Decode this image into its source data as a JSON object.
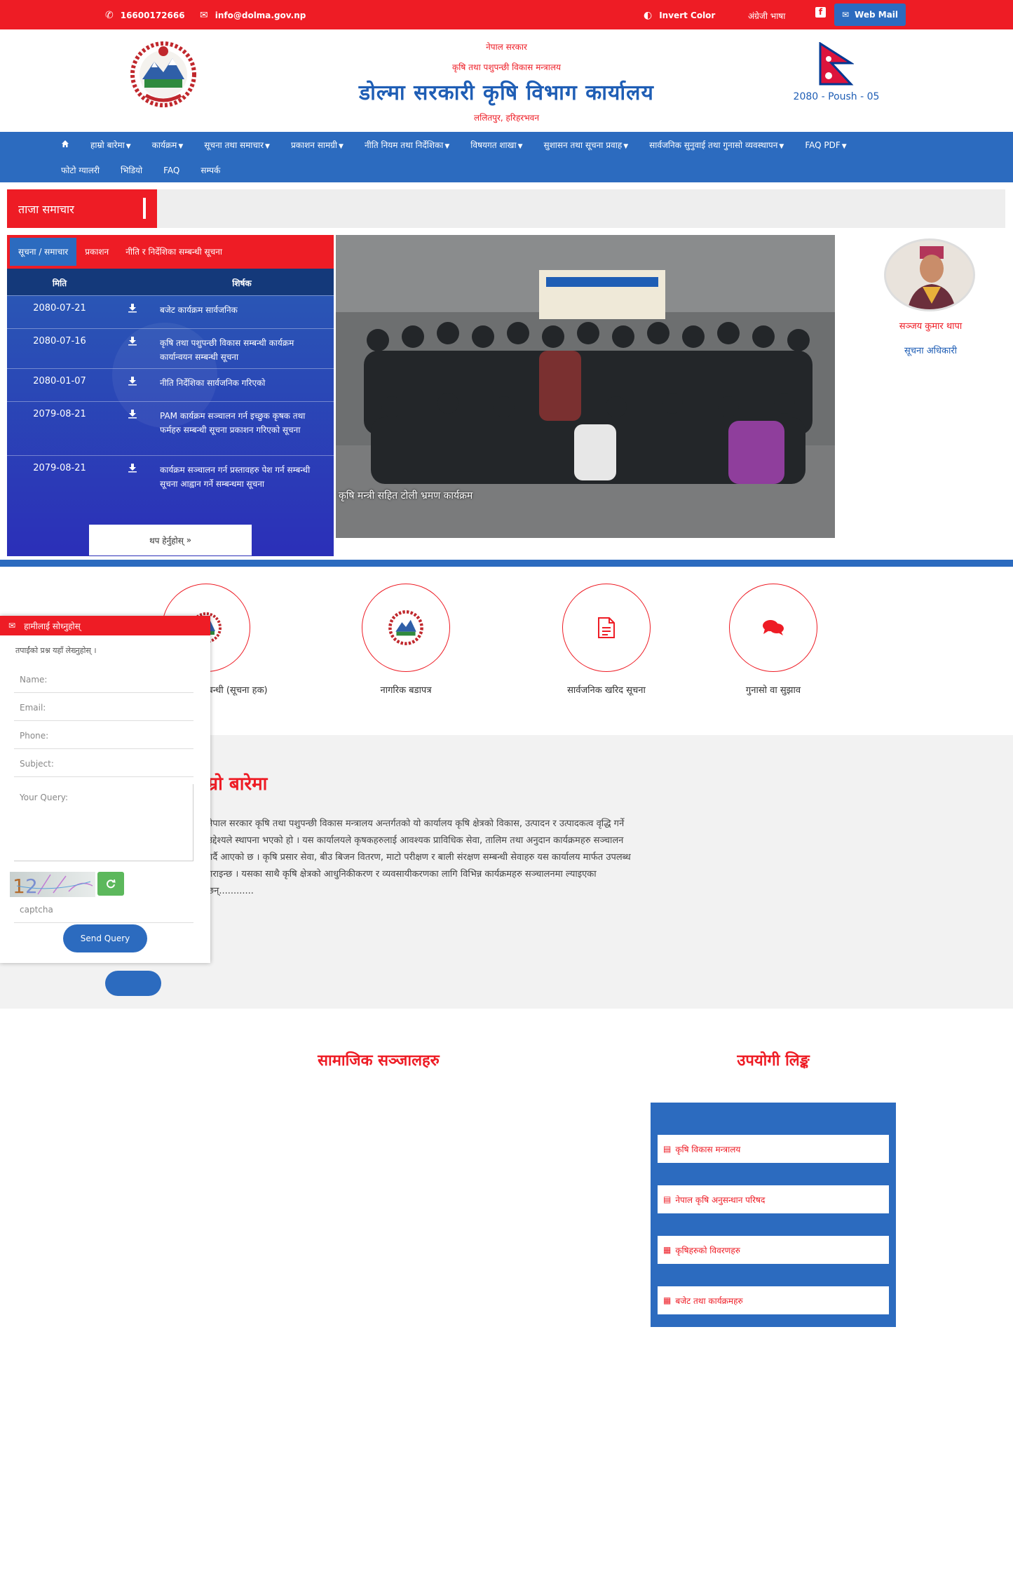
{
  "topbar": {
    "phone": "16600172666",
    "email": "info@dolma.gov.np",
    "invert_color": "Invert Color",
    "language": "अंग्रेजी भाषा",
    "webmail": "Web Mail"
  },
  "header": {
    "line1": "नेपाल सरकार",
    "line2": "कृषि तथा पशुपन्छी विकास मन्त्रालय",
    "title": "डोल्मा सरकारी कृषि विभाग कार्यालय",
    "address": "ललितपुर, हरिहरभवन",
    "date": "2080 - Poush - 05"
  },
  "nav": {
    "row1": [
      "हाम्रो बारेमा",
      "कार्यक्रम",
      "सूचना तथा समाचार",
      "प्रकाशन सामग्री",
      "नीति नियम तथा निर्देशिका",
      "विषयगत शाखा",
      "सुशासन तथा सूचना प्रवाह",
      "सार्वजनिक सुनुवाई तथा गुनासो व्यवस्थापन",
      "FAQ PDF"
    ],
    "row1_dropdown": [
      true,
      true,
      true,
      true,
      true,
      true,
      true,
      true,
      true
    ],
    "row2": [
      "फोटो ग्यालरी",
      "भिडियो",
      "FAQ",
      "सम्पर्क"
    ]
  },
  "news": {
    "label": "ताजा समाचार"
  },
  "tabs": {
    "items": [
      "सूचना / समाचार",
      "प्रकाशन",
      "नीति र निर्देशिका सम्बन्धी सूचना"
    ],
    "col_date": "मिति",
    "col_title": "शिर्षक",
    "rows": [
      {
        "date": "2080-07-21",
        "title": "बजेट कार्यक्रम सार्वजनिक"
      },
      {
        "date": "2080-07-16",
        "title": "कृषि तथा पशुपन्छी विकास सम्बन्धी कार्यक्रम कार्यान्वयन सम्बन्धी सूचना"
      },
      {
        "date": "2080-01-07",
        "title": "नीति निर्देशिका सार्वजनिक गरिएको"
      },
      {
        "date": "2079-08-21",
        "title": "PAM कार्यक्रम सञ्चालन गर्न इच्छुक कृषक तथा फर्महरु सम्बन्धी सूचना प्रकाशन गरिएको सूचना"
      },
      {
        "date": "2079-08-21",
        "title": "कार्यक्रम सञ्चालन गर्न प्रस्तावहरु पेश गर्न सम्बन्धी सूचना आह्वान गर्ने सम्बन्धमा सूचना"
      }
    ],
    "more": "थप हेर्नुहोस्"
  },
  "photo": {
    "caption": "कृषि मन्त्री सहित टोली भ्रमण कार्यक्रम"
  },
  "profile": {
    "name": "सञ्जय कुमार थापा",
    "role": "सूचना अधिकारी"
  },
  "services": [
    {
      "label": "नागरिक वडापत्र सम्बन्धी (सूचना हक)"
    },
    {
      "label": "नागरिक बडापत्र"
    },
    {
      "label": "सार्वजनिक खरिद सूचना"
    },
    {
      "label": "गुनासो वा सुझाव"
    }
  ],
  "about": {
    "title": "हाम्रो बारेमा",
    "text": "नेपाल सरकार कृषि तथा पशुपन्छी विकास मन्त्रालय अन्तर्गतको यो कार्यालय कृषि क्षेत्रको विकास, उत्पादन र उत्पादकत्व वृद्धि गर्ने उद्देश्यले स्थापना भएको हो । यस कार्यालयले कृषकहरुलाई आवश्यक प्राविधिक सेवा, तालिम तथा अनुदान कार्यक्रमहरु सञ्चालन गर्दै आएको छ । कृषि प्रसार सेवा, बीउ बिजन वितरण, माटो परीक्षण र बाली संरक्षण सम्बन्धी सेवाहरु यस कार्यालय मार्फत उपलब्ध गराइन्छ । यसका साथै कृषि क्षेत्रको आधुनिकीकरण र व्यवसायीकरणका लागि विभिन्न कार्यक्रमहरु सञ्चालनमा ल्याइएका छन्............"
  },
  "contact": {
    "header": "हामीलाई सोध्नुहोस्",
    "intro": "तपाईंको प्रश्न यहाँ लेख्नुहोस् ।",
    "name_placeholder": "Name:",
    "email_placeholder": "Email:",
    "phone_placeholder": "Phone:",
    "subject_placeholder": "Subject:",
    "query_placeholder": "Your Query:",
    "captcha_placeholder": "captcha",
    "send": "Send Query"
  },
  "bottom": {
    "left_title": "सामाजिक सञ्जालहरु",
    "right_title": "उपयोगी लिङ्क",
    "links": [
      "कृषि विकास मन्त्रालय",
      "नेपाल कृषि अनुसन्धान परिषद",
      "कृषिहरुको विवरणहरु",
      "बजेट तथा कार्यक्रमहरु"
    ]
  },
  "colors": {
    "red": "#ee1c25",
    "blue": "#2c6bbf"
  }
}
